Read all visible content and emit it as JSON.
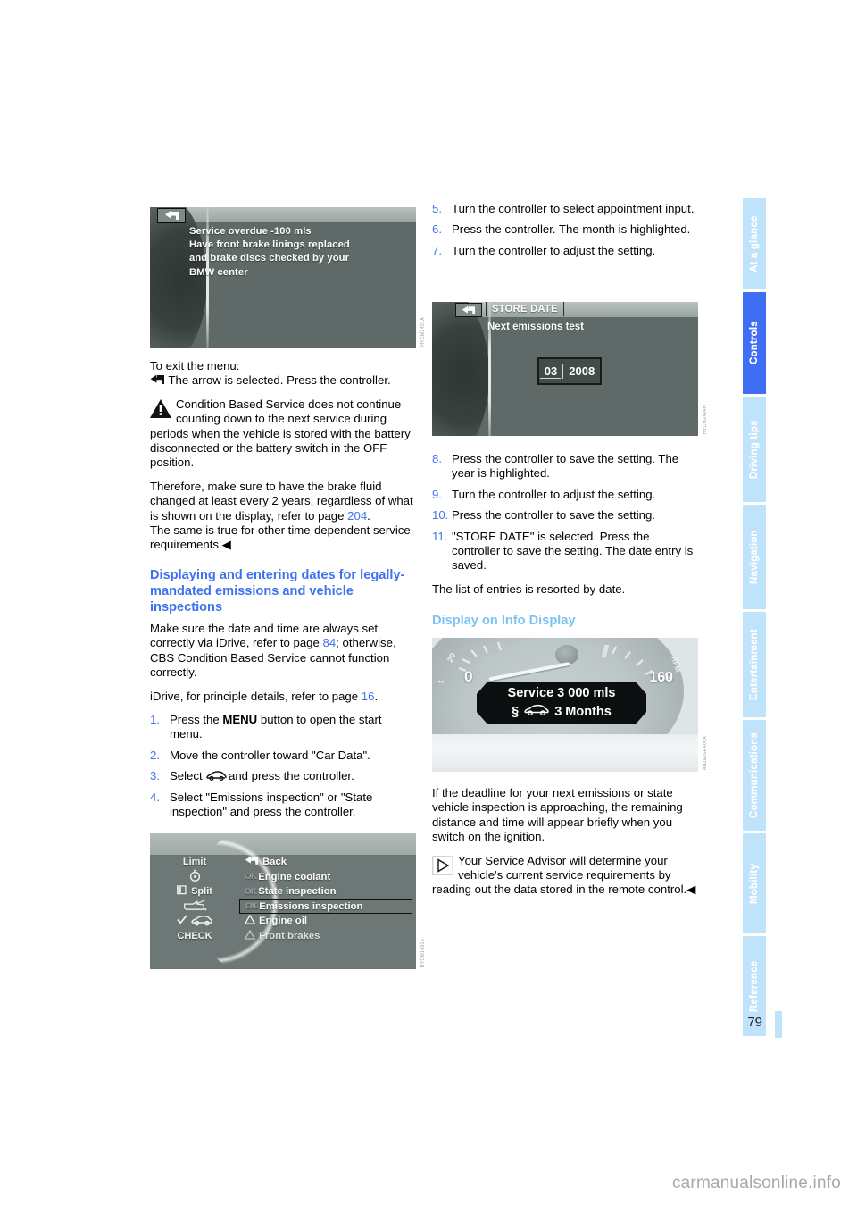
{
  "page_number": "79",
  "watermark": "carmanualsonline.info",
  "colors": {
    "heading_blue": "#3f72ee",
    "subheading_blue": "#7cc3f2",
    "tab_active": "#3f6ef4",
    "tab_inactive": "#bfe3fb",
    "link_blue": "#3f72ee"
  },
  "sidebar": {
    "items": [
      {
        "label": "At a glance",
        "active": false
      },
      {
        "label": "Controls",
        "active": true
      },
      {
        "label": "Driving tips",
        "active": false
      },
      {
        "label": "Navigation",
        "active": false
      },
      {
        "label": "Entertainment",
        "active": false
      },
      {
        "label": "Communications",
        "active": false
      },
      {
        "label": "Mobility",
        "active": false
      },
      {
        "label": "Reference",
        "active": false
      }
    ]
  },
  "left_column": {
    "figure_cbs_message": {
      "caption": "HYCM2401A",
      "back_icon": "back-arrow-icon",
      "lines": [
        "Service overdue -100 mls",
        "Have front brake linings replaced",
        "and brake discs checked by your",
        "BMW center"
      ]
    },
    "exit_menu_label": "To exit the menu:",
    "exit_menu_text": "The arrow is selected. Press the controller.",
    "warning_note": "Condition Based Service does not continue counting down to the next service during periods when the vehicle is stored with the battery disconnected or the battery switch in the OFF position.",
    "warning_para2_a": "Therefore, make sure to have the brake fluid changed at least every 2 years, regardless of what is shown on the display, refer to page ",
    "warning_para2_ref": "204",
    "warning_para2_b": ".",
    "warning_para3": "The same is true for other time-dependent service requirements.",
    "heading": "Displaying and entering dates for legally-mandated emissions and vehicle inspections",
    "intro_a": "Make sure the date and time are always set correctly via iDrive, refer to page ",
    "intro_ref": "84",
    "intro_b": "; otherwise, CBS Condition Based Service cannot function correctly.",
    "idrive_a": "iDrive, for principle details, refer to page ",
    "idrive_ref": "16",
    "idrive_b": ".",
    "steps": [
      {
        "num": "1.",
        "pre": "Press the ",
        "bold": "MENU",
        "post": " button to open the start menu."
      },
      {
        "num": "2.",
        "pre": "Move the controller toward \"Car Data\".",
        "bold": "",
        "post": ""
      },
      {
        "num": "3.",
        "pre": "Select ",
        "bold": "",
        "post": " and press the controller.",
        "icon": "car-icon"
      },
      {
        "num": "4.",
        "pre": "Select \"Emissions inspection\" or \"State inspection\" and press the controller.",
        "bold": "",
        "post": ""
      }
    ],
    "figure_menu": {
      "caption": "HYCM1401b",
      "left_items": [
        "Limit",
        "clock-icon",
        "Split",
        "oil-can-icon",
        "car-icon",
        "CHECK"
      ],
      "right_items": [
        {
          "prefix": "",
          "label": "Back",
          "icon": "back-arrow-icon",
          "selected": false
        },
        {
          "prefix": "OK",
          "label": "Engine coolant",
          "selected": false
        },
        {
          "prefix": "OK",
          "label": "State inspection",
          "selected": false
        },
        {
          "prefix": "OK",
          "label": "Emissions inspection",
          "selected": true
        },
        {
          "prefix": "triangle",
          "label": "Engine oil",
          "selected": false
        },
        {
          "prefix": "triangle",
          "label": "Front brakes",
          "selected": false
        }
      ]
    }
  },
  "right_column": {
    "steps_top": [
      {
        "num": "5.",
        "text": "Turn the controller to select appointment input."
      },
      {
        "num": "6.",
        "text": "Press the controller. The month is highlighted."
      },
      {
        "num": "7.",
        "text": "Turn the controller to adjust the setting."
      }
    ],
    "figure_store_date": {
      "caption": "HYCM2404H",
      "back_icon": "back-arrow-icon",
      "button_label": "STORE DATE",
      "subtitle": "Next  emissions test",
      "month": "03",
      "year": "2008"
    },
    "steps_bottom": [
      {
        "num": "8.",
        "text": "Press the controller to save the setting. The year is highlighted."
      },
      {
        "num": "9.",
        "text": "Turn the controller to adjust the setting."
      },
      {
        "num": "10.",
        "text": "Press the controller to save the setting."
      },
      {
        "num": "11.",
        "text": "\"STORE DATE\" is selected. Press the controller to save the setting. The date entry is saved."
      }
    ],
    "resort_text": "The list of entries is resorted by date.",
    "subheading": "Display on Info Display",
    "figure_cluster": {
      "caption": "ANZEIGE40dA",
      "zero_label": "0",
      "max_label": "160",
      "line1": "Service 3 000 mls",
      "line2_symbol": "§",
      "line2_icon": "car-icon",
      "line2": "3 Months"
    },
    "deadline_text": "If the deadline for your next emissions or state vehicle inspection is approaching, the remaining distance and time will appear briefly when you switch on the ignition.",
    "advisor_note": "Your Service Advisor will determine your vehicle's current service requirements by reading out the data stored in the remote control."
  }
}
